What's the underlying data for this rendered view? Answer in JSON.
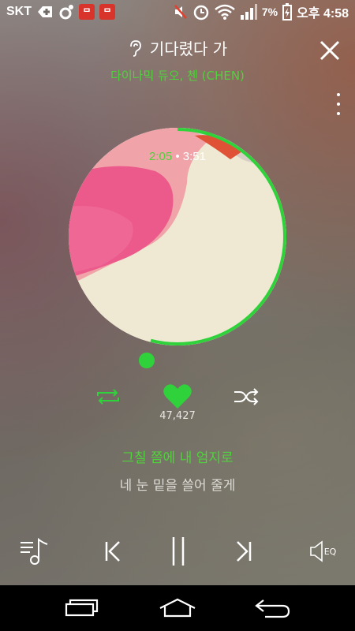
{
  "status_bar": {
    "carrier": "SKT",
    "battery": "7%",
    "time": "오후 4:58",
    "app_icon_label": "ᄆ"
  },
  "player": {
    "title": "기다렸다 가",
    "artist": "다이나믹 듀오, 첸 (CHEN)",
    "time_elapsed": "2:05",
    "time_separator": "•",
    "time_total": "3:51",
    "progress_fraction": 0.54,
    "like_count": "47,427"
  },
  "lyrics": {
    "current": "그칠 쯤에 내 엄지로",
    "next": "네 눈 밑을 쓸어 줄게"
  },
  "controls": {
    "eq_label": "EQ"
  },
  "colors": {
    "accent": "#2fd23a",
    "accent_text": "#4fd23b"
  },
  "icons": {
    "close": "close-icon",
    "more": "more-vertical-icon",
    "repeat": "repeat-icon",
    "like": "heart-icon",
    "shuffle": "shuffle-icon",
    "playlist": "playlist-icon",
    "prev": "previous-icon",
    "pause": "pause-icon",
    "next": "next-icon",
    "eq": "eq-icon"
  }
}
